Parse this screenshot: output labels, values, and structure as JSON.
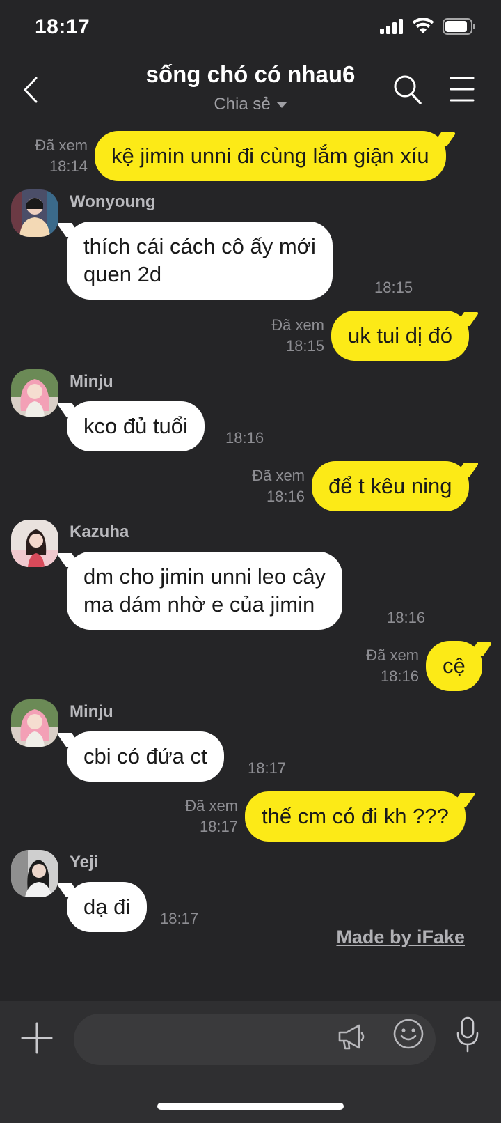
{
  "status_bar": {
    "time": "18:17"
  },
  "header": {
    "title": "sống chó có nhau",
    "member_count": "6",
    "subtitle": "Chia sẻ"
  },
  "messages": [
    {
      "type": "out",
      "text": "kệ jimin unni đi cùng lắm giận xíu",
      "read": "Đã xem",
      "time": "18:14"
    },
    {
      "type": "in",
      "sender": "Wonyoung",
      "lines": [
        "thích cái cách cô ấy mới",
        "quen 2d"
      ],
      "time": "18:15"
    },
    {
      "type": "out",
      "text": "uk tui dị đó",
      "read": "Đã xem",
      "time": "18:15"
    },
    {
      "type": "in",
      "sender": "Minju",
      "lines": [
        "kco đủ tuổi"
      ],
      "time": "18:16"
    },
    {
      "type": "out",
      "text": "để t kêu ning",
      "read": "Đã xem",
      "time": "18:16"
    },
    {
      "type": "in",
      "sender": "Kazuha",
      "lines": [
        "dm cho jimin unni leo cây",
        "ma dám nhờ e của jimin"
      ],
      "time": "18:16"
    },
    {
      "type": "out",
      "text": "cệ",
      "read": "Đã xem",
      "time": "18:16"
    },
    {
      "type": "in",
      "sender": "Minju",
      "lines": [
        "cbi có đứa ct"
      ],
      "time": "18:17"
    },
    {
      "type": "out",
      "text": "thế cm có đi kh ???",
      "read": "Đã xem",
      "time": "18:17"
    },
    {
      "type": "in",
      "sender": "Yeji",
      "lines": [
        "dạ đi"
      ],
      "time": "18:17"
    }
  ],
  "watermark": "Made by iFake",
  "input": {
    "placeholder": ""
  },
  "icons": {
    "back": "chevron-left-icon",
    "search": "search-icon",
    "menu": "menu-icon",
    "plus": "plus-icon",
    "shout": "megaphone-icon",
    "emoji": "emoji-icon",
    "mic": "microphone-icon"
  },
  "colors": {
    "background": "#252527",
    "outgoing_bubble": "#fcea17",
    "incoming_bubble": "#ffffff",
    "meta_text": "#8e8e93"
  }
}
